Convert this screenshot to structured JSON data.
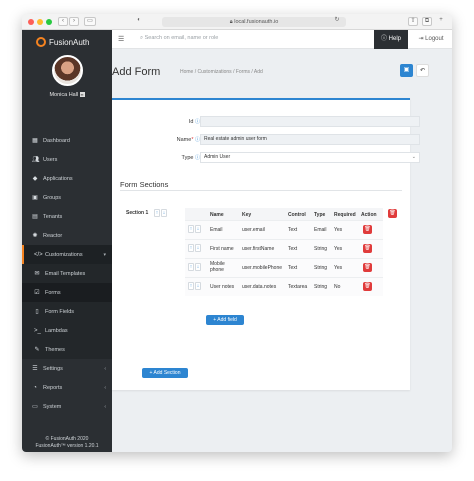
{
  "browser": {
    "url": "local.fusionauth.io"
  },
  "brand": {
    "name": "FusionAuth",
    "accent": "#f58320"
  },
  "user": {
    "name": "Monica Hall",
    "badge": "✉"
  },
  "sidebar": {
    "items": [
      {
        "label": "Dashboard",
        "icon": "dashboard-icon"
      },
      {
        "label": "Users",
        "icon": "users-icon"
      },
      {
        "label": "Applications",
        "icon": "applications-icon"
      },
      {
        "label": "Groups",
        "icon": "groups-icon"
      },
      {
        "label": "Tenants",
        "icon": "tenants-icon"
      },
      {
        "label": "Reactor",
        "icon": "reactor-icon"
      },
      {
        "label": "Customizations",
        "icon": "code-icon"
      },
      {
        "label": "Email Templates",
        "icon": "email-icon"
      },
      {
        "label": "Forms",
        "icon": "forms-icon"
      },
      {
        "label": "Form Fields",
        "icon": "form-fields-icon"
      },
      {
        "label": "Lambdas",
        "icon": "lambdas-icon"
      },
      {
        "label": "Themes",
        "icon": "themes-icon"
      },
      {
        "label": "Settings",
        "icon": "settings-icon"
      },
      {
        "label": "Reports",
        "icon": "reports-icon"
      },
      {
        "label": "System",
        "icon": "system-icon"
      }
    ],
    "footer_line1": "© FusionAuth 2020",
    "footer_line2": "FusionAuth™ version 1.20.1"
  },
  "topbar": {
    "search_placeholder": "Search on email, name or role",
    "help_label": "Help",
    "logout_label": "Logout"
  },
  "page": {
    "title": "Add Form",
    "breadcrumbs": "Home  /  Customizations  /  Forms  /  Add"
  },
  "form": {
    "id_label": "Id",
    "id_value": "",
    "name_label": "Name",
    "name_value": "Real estate admin user form",
    "type_label": "Type",
    "type_value": "Admin User",
    "sections_title": "Form Sections",
    "section_label": "Section 1",
    "columns": [
      "Name",
      "Key",
      "Control",
      "Type",
      "Required",
      "Action"
    ],
    "rows": [
      {
        "name": "Email",
        "key": "user.email",
        "control": "Text",
        "type": "Email",
        "required": "Yes"
      },
      {
        "name": "First name",
        "key": "user.firstName",
        "control": "Text",
        "type": "String",
        "required": "Yes"
      },
      {
        "name": "Mobile phone",
        "key": "user.mobilePhone",
        "control": "Text",
        "type": "String",
        "required": "Yes"
      },
      {
        "name": "User notes",
        "key": "user.data.notes",
        "control": "Textarea",
        "type": "String",
        "required": "No"
      }
    ],
    "add_field_label": "+ Add field",
    "add_section_label": "+ Add Section"
  },
  "colors": {
    "primary": "#2d85d1",
    "danger": "#e03b3b",
    "sidebar": "#2b2f33"
  }
}
